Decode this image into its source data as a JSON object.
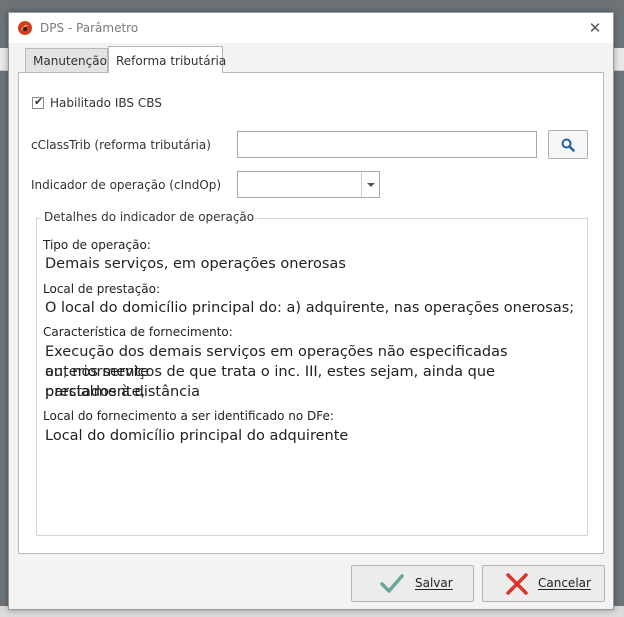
{
  "window": {
    "title": "DPS - Parâmetro",
    "close_icon": "close-icon"
  },
  "tabs": [
    {
      "label": "Manutenção",
      "active": false
    },
    {
      "label": "Reforma tributária",
      "active": true
    }
  ],
  "form": {
    "ibs_cbs": {
      "label": "Habilitado IBS CBS",
      "checked": true
    },
    "cclasstrib": {
      "label": "cClassTrib (reforma tributária)",
      "value": ""
    },
    "cindop": {
      "label": "Indicador de operação (cIndOp)",
      "value": ""
    }
  },
  "details": {
    "legend": "Detalhes do indicador de operação",
    "tipo_label": "Tipo de operação:",
    "tipo_value": "Demais serviços, em operações onerosas",
    "local_label": "Local de prestação:",
    "local_value": "O local do domicílio principal do: a) adquirente, nas operações onerosas;",
    "carac_label": "Característica de fornecimento:",
    "carac_line1": "Execução dos demais serviços em operações não especificadas anteriormente",
    "carac_line2": "ou, nos serviços de que trata o inc. III, estes sejam, ainda que parcialmente,",
    "carac_line3": "prestados à distância",
    "dfe_label": "Local do fornecimento a ser identificado no DFe:",
    "dfe_value": "Local do domicílio principal do adquirente"
  },
  "buttons": {
    "save": "Salvar",
    "cancel": "Cancelar"
  },
  "colors": {
    "save_check": "#6aa79a",
    "cancel_x": "#d9362c",
    "search_icon": "#1f5fa6",
    "app_icon": "#d63c1f"
  }
}
